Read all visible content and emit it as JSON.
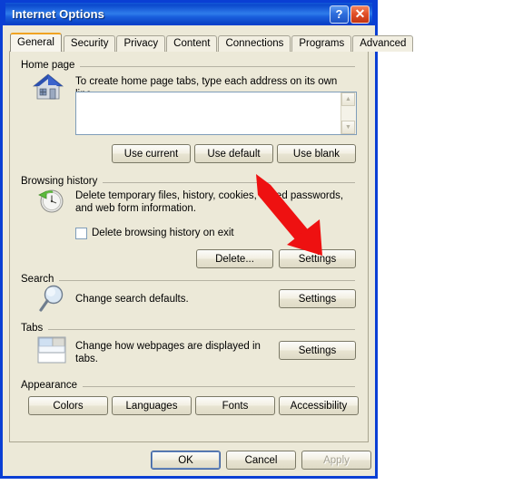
{
  "window": {
    "title": "Internet Options",
    "help_button": "?",
    "close_button": "✕"
  },
  "tabs": [
    {
      "label": "General",
      "active": true
    },
    {
      "label": "Security",
      "active": false
    },
    {
      "label": "Privacy",
      "active": false
    },
    {
      "label": "Content",
      "active": false
    },
    {
      "label": "Connections",
      "active": false
    },
    {
      "label": "Programs",
      "active": false
    },
    {
      "label": "Advanced",
      "active": false
    }
  ],
  "sections": {
    "home_page": {
      "legend": "Home page",
      "icon": "house-icon",
      "description": "To create home page tabs, type each address on its own line.",
      "input_value": "",
      "input_placeholder": "",
      "buttons": [
        "Use current",
        "Use default",
        "Use blank"
      ]
    },
    "browsing_history": {
      "legend": "Browsing history",
      "icon": "clock-history-icon",
      "description_line1": "Delete temporary files, history, cookies, saved passwords,",
      "description_line2": "and web form information.",
      "checkbox_label": "Delete browsing history on exit",
      "checkbox_checked": false,
      "buttons": [
        "Delete...",
        "Settings"
      ]
    },
    "search": {
      "legend": "Search",
      "icon": "magnifier-icon",
      "description": "Change search defaults.",
      "button": "Settings"
    },
    "tabs_section": {
      "legend": "Tabs",
      "icon": "tabs-window-icon",
      "description_line1": "Change how webpages are displayed in",
      "description_line2": "tabs.",
      "button": "Settings"
    },
    "appearance": {
      "legend": "Appearance",
      "buttons": [
        "Colors",
        "Languages",
        "Fonts",
        "Accessibility"
      ]
    }
  },
  "footer": {
    "ok": "OK",
    "cancel": "Cancel",
    "apply": "Apply",
    "apply_disabled": true
  },
  "annotation": {
    "type": "red-arrow",
    "points_to": "browsing-history-settings-button",
    "color": "#ee1111"
  },
  "colors": {
    "titlebar_blue": "#0a3fd4",
    "dialog_face": "#ece9d8",
    "active_tab_accent": "#f0a322",
    "arrow_red": "#ee1111"
  }
}
